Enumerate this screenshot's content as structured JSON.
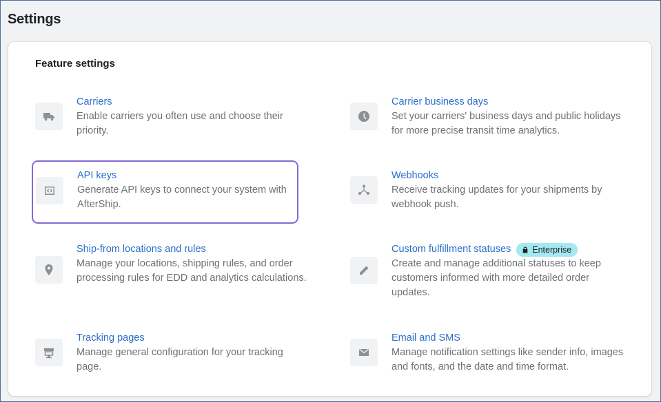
{
  "page": {
    "title": "Settings"
  },
  "feature_settings": {
    "title": "Feature settings",
    "items": [
      {
        "title": "Carriers",
        "description": "Enable carriers you often use and choose their priority.",
        "icon": "truck-icon"
      },
      {
        "title": "Carrier business days",
        "description": "Set your carriers' business days and public holidays for more precise transit time analytics.",
        "icon": "clock-icon"
      },
      {
        "title": "API keys",
        "description": "Generate API keys to connect your system with AfterShip.",
        "icon": "code-icon"
      },
      {
        "title": "Webhooks",
        "description": "Receive tracking updates for your shipments by webhook push.",
        "icon": "webhook-icon"
      },
      {
        "title": "Ship-from locations and rules",
        "description": "Manage your locations, shipping rules, and order processing rules for EDD and analytics calculations.",
        "icon": "location-pin-icon"
      },
      {
        "title": "Custom fulfillment statuses",
        "badge": "Enterprise",
        "badge_icon": "lock-icon",
        "description": "Create and manage additional statuses to keep customers informed with more detailed order updates.",
        "icon": "pencil-icon"
      },
      {
        "title": "Tracking pages",
        "description": "Manage general configuration for your tracking page.",
        "icon": "storefront-icon"
      },
      {
        "title": "Email and SMS",
        "description": "Manage notification settings like sender info, images and fonts, and the date and time format.",
        "icon": "envelope-icon"
      }
    ]
  },
  "colors": {
    "link": "#2c6ecb",
    "badge_bg": "#a4e8f2",
    "highlight_border": "#8467d8"
  }
}
